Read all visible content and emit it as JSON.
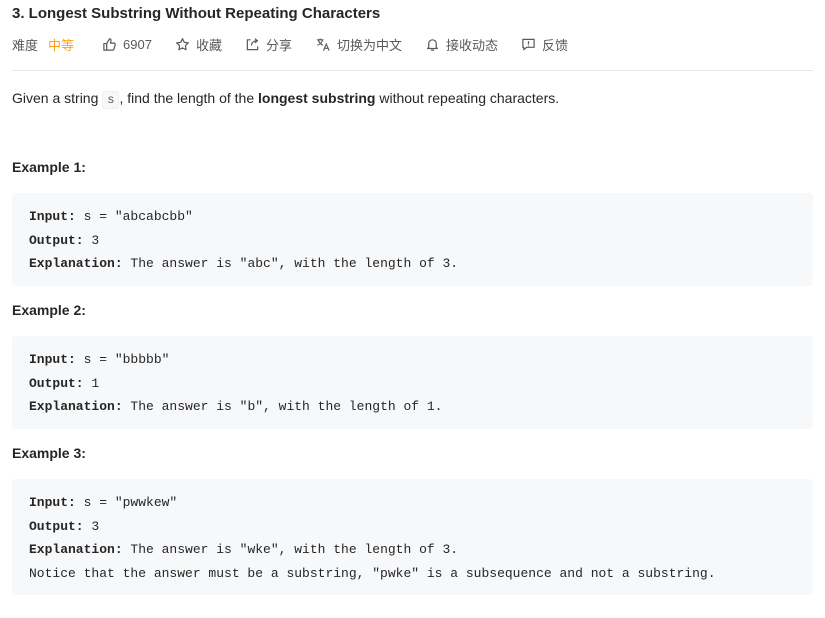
{
  "problem": {
    "title": "3. Longest Substring Without Repeating Characters"
  },
  "meta": {
    "difficulty_label": "难度",
    "difficulty_value": "中等",
    "likes": "6907",
    "favorite_label": "收藏",
    "share_label": "分享",
    "translate_label": "切换为中文",
    "subscribe_label": "接收动态",
    "feedback_label": "反馈",
    "accent_color": "#ffa116"
  },
  "description": {
    "prefix": "Given a string ",
    "code": "s",
    "middle": ", find the length of the ",
    "bold": "longest substring",
    "suffix": " without repeating characters."
  },
  "examples": [
    {
      "title": "Example 1:",
      "input_key": "Input:",
      "input_value": " s = \"abcabcbb\"",
      "output_key": "Output:",
      "output_value": " 3",
      "explanation_key": "Explanation:",
      "explanation_value": " The answer is \"abc\", with the length of 3.",
      "extra": ""
    },
    {
      "title": "Example 2:",
      "input_key": "Input:",
      "input_value": " s = \"bbbbb\"",
      "output_key": "Output:",
      "output_value": " 1",
      "explanation_key": "Explanation:",
      "explanation_value": " The answer is \"b\", with the length of 1.",
      "extra": ""
    },
    {
      "title": "Example 3:",
      "input_key": "Input:",
      "input_value": " s = \"pwwkew\"",
      "output_key": "Output:",
      "output_value": " 3",
      "explanation_key": "Explanation:",
      "explanation_value": " The answer is \"wke\", with the length of 3.",
      "extra": "Notice that the answer must be a substring, \"pwke\" is a subsequence and not a substring."
    }
  ]
}
